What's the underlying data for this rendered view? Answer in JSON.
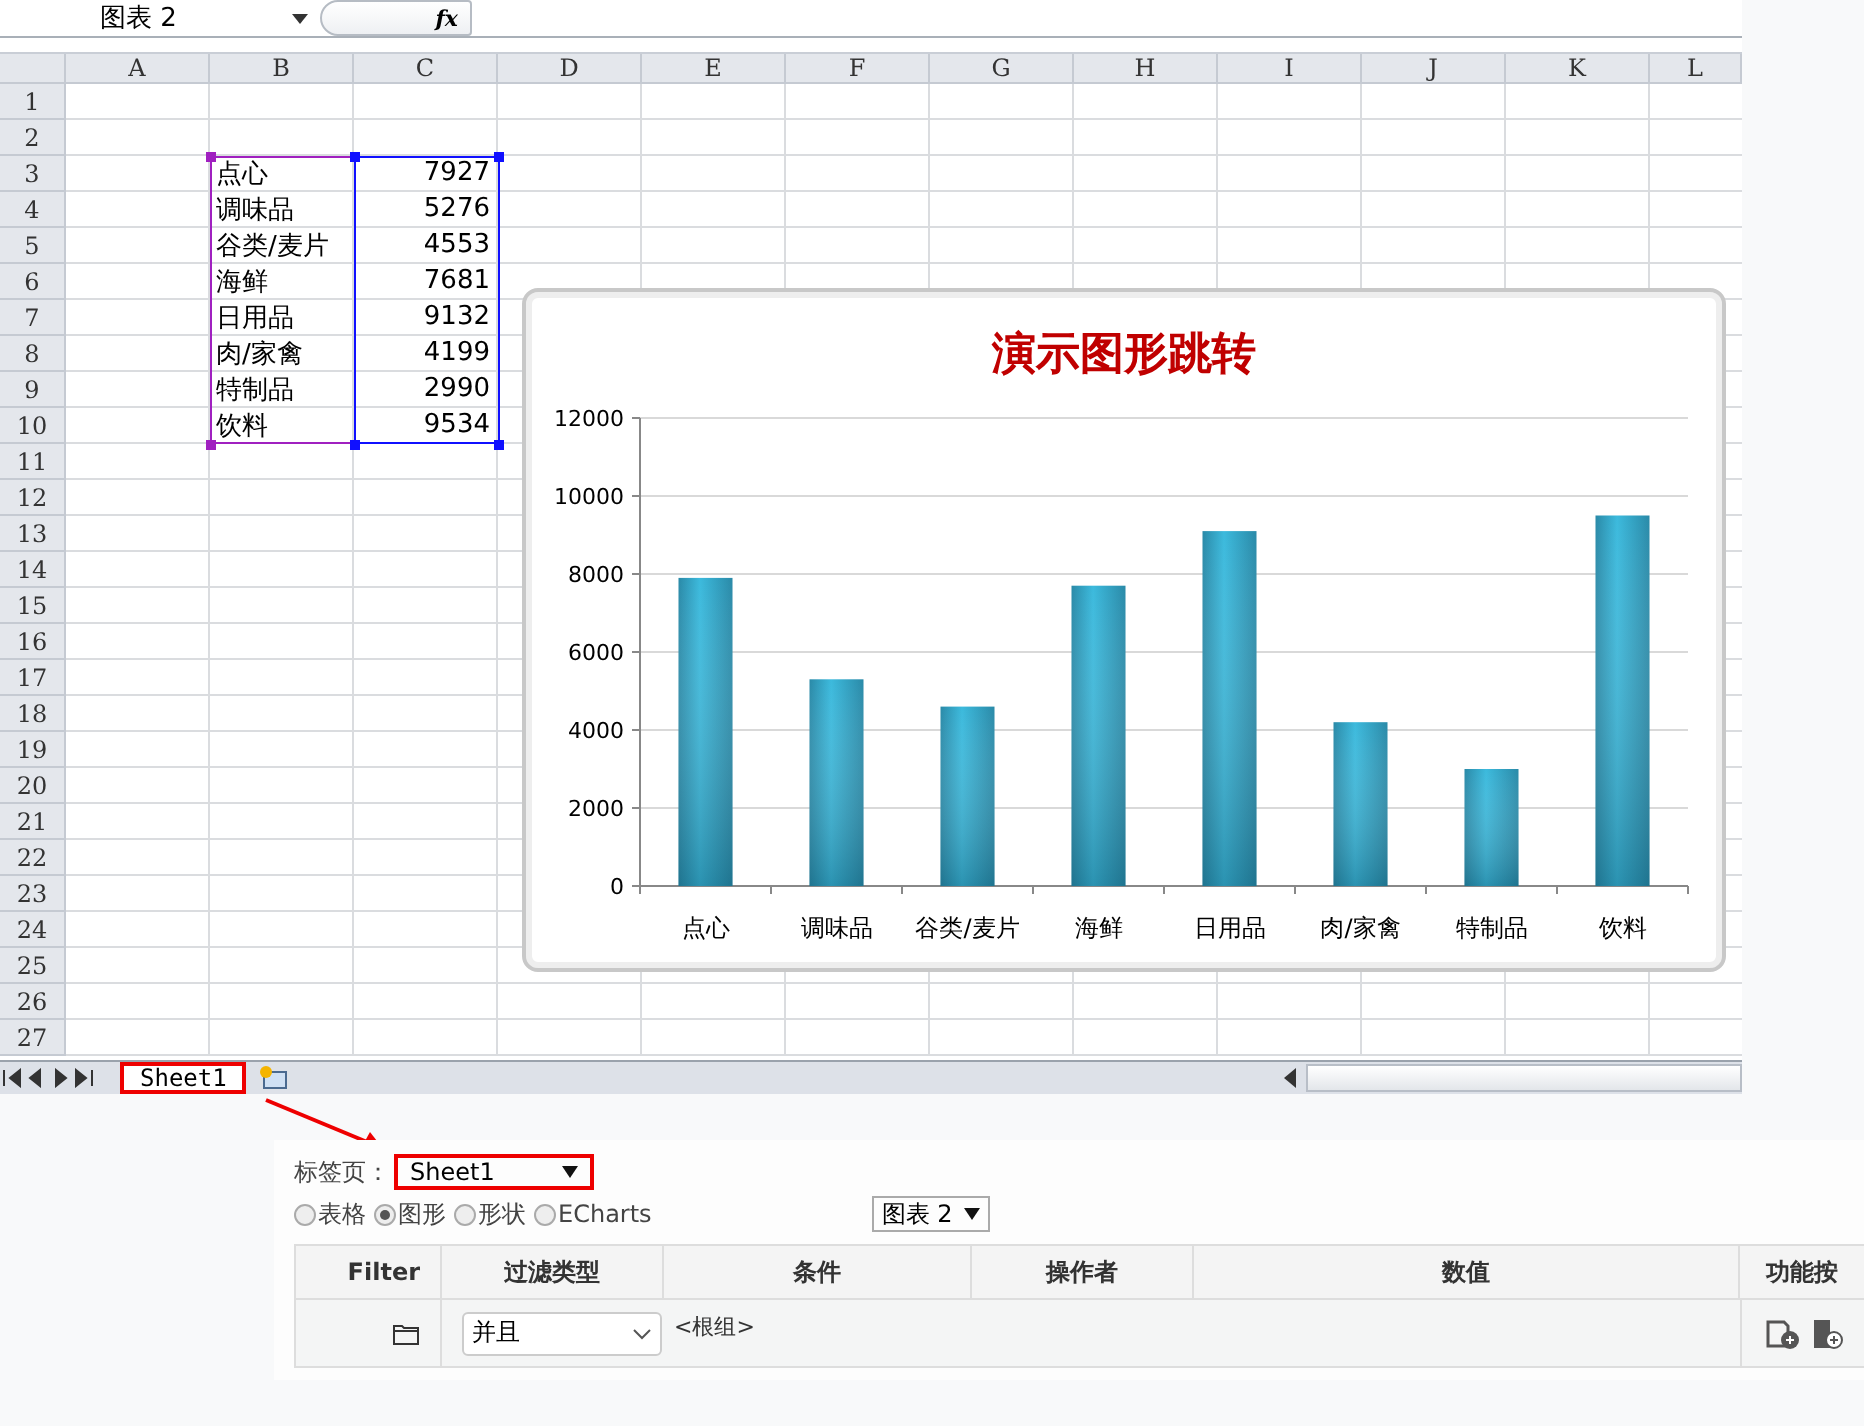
{
  "formula_bar": {
    "name_box": "图表 2",
    "fx": "fx"
  },
  "sheet": {
    "columns": [
      "A",
      "B",
      "C",
      "D",
      "E",
      "F",
      "G",
      "H",
      "I",
      "J",
      "K",
      "L"
    ],
    "rows": [
      "1",
      "2",
      "3",
      "4",
      "5",
      "6",
      "7",
      "8",
      "9",
      "10",
      "11",
      "12",
      "13",
      "14",
      "15",
      "16",
      "17",
      "18",
      "19",
      "20",
      "21",
      "22",
      "23",
      "24",
      "25",
      "26",
      "27"
    ],
    "range_selected": true,
    "data_rows": [
      {
        "label": "点心",
        "value": "7927"
      },
      {
        "label": "调味品",
        "value": "5276"
      },
      {
        "label": "谷类/麦片",
        "value": "4553"
      },
      {
        "label": "海鲜",
        "value": "7681"
      },
      {
        "label": "日用品",
        "value": "9132"
      },
      {
        "label": "肉/家禽",
        "value": "4199"
      },
      {
        "label": "特制品",
        "value": "2990"
      },
      {
        "label": "饮料",
        "value": "9534"
      }
    ],
    "chart_data": {
      "type": "bar",
      "title": "演示图形跳转",
      "categories": [
        "点心",
        "调味品",
        "谷类/麦片",
        "海鲜",
        "日用品",
        "肉/家禽",
        "特制品",
        "饮料"
      ],
      "values": [
        7900,
        5300,
        4600,
        7700,
        9100,
        4200,
        3000,
        9500
      ],
      "grid": true,
      "ylim": [
        0,
        12000
      ],
      "yticks": [
        0,
        2000,
        4000,
        6000,
        8000,
        10000,
        12000
      ]
    }
  },
  "sheet_tabs": [
    {
      "label": "Sheet1",
      "selected": true,
      "highlighted": true
    }
  ],
  "panel": {
    "tab_label": "标签页：",
    "tab_select": {
      "value": "Sheet1",
      "highlighted": true
    },
    "radios": [
      {
        "label": "表格",
        "selected": false
      },
      {
        "label": "图形",
        "selected": true
      },
      {
        "label": "形状",
        "selected": false
      },
      {
        "label": "ECharts",
        "selected": false
      }
    ],
    "chart_select": "图表 2",
    "table": {
      "columns": [
        "Filter",
        "过滤类型",
        "条件",
        "操作者",
        "数值",
        "功能按"
      ],
      "rows": [
        {
          "filter_type": "并且",
          "condition": "<根组>"
        }
      ]
    }
  }
}
